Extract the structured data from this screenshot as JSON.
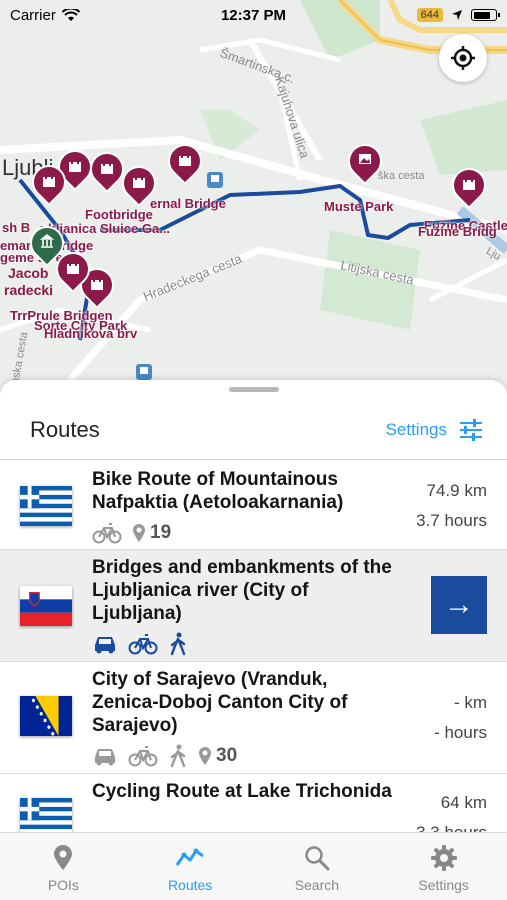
{
  "status_bar": {
    "carrier": "Carrier",
    "time": "12:37 PM",
    "road_badge": "644"
  },
  "map": {
    "street_labels": [
      "Šmartinska c.",
      "Kajuhova ulica",
      "Hradeckega cesta",
      "Litijska cesta",
      "Ljublj",
      "Jacob",
      "radecki",
      "ška cesta",
      "anska cesta",
      "Lju"
    ],
    "poi_labels": [
      "ernal Bridge",
      "Footbridge",
      "sh B",
      "ubljanica Sluice Ga...",
      "Muste Park",
      "Fužine Castle",
      "Fužine Bridg",
      "emanck Bridge",
      "geme se em...",
      "TrrPrule Bridgen",
      "Sorte City Park",
      "Hladnikova brv"
    ]
  },
  "sheet": {
    "title": "Routes",
    "settings_label": "Settings"
  },
  "routes": [
    {
      "name": "Bike Route of Mountainous Nafpaktia (Aetoloakarnania)",
      "flag": "greece",
      "modes": [
        "bike"
      ],
      "poi_count": "19",
      "distance": "74.9 km",
      "duration": "3.7 hours",
      "selected": false
    },
    {
      "name": "Bridges and embankments of the Ljubljanica river (City of Ljubljana)",
      "flag": "slovenia",
      "modes": [
        "car",
        "bike",
        "walk"
      ],
      "selected": true,
      "action": "→"
    },
    {
      "name": "City of Sarajevo (Vranduk, Zenica-Doboj Canton City of Sarajevo)",
      "flag": "bosnia",
      "modes": [
        "car",
        "bike",
        "walk"
      ],
      "poi_count": "30",
      "distance": "- km",
      "duration": "- hours",
      "selected": false
    },
    {
      "name": "Cycling Route at Lake Trichonida",
      "flag": "greece",
      "distance": "64 km",
      "duration": "3.3 hours",
      "selected": false
    }
  ],
  "tabs": [
    {
      "label": "POIs",
      "icon": "map-pin-icon"
    },
    {
      "label": "Routes",
      "icon": "route-icon",
      "active": true
    },
    {
      "label": "Search",
      "icon": "search-icon"
    },
    {
      "label": "Settings",
      "icon": "gear-icon"
    }
  ],
  "colors": {
    "accent": "#2a9df4",
    "poi": "#8b1a4a",
    "route_line": "#1a4b9c",
    "action_button": "#1a4b9c"
  }
}
